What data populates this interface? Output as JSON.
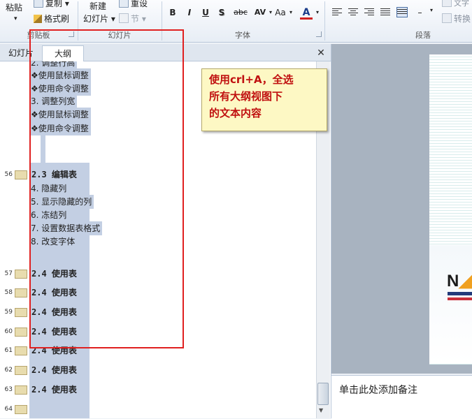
{
  "ribbon": {
    "clipboard": {
      "paste": "粘贴",
      "copy": "复制",
      "format_painter": "格式刷",
      "group_label": "剪贴板"
    },
    "slides": {
      "new_slide_line1": "新建",
      "new_slide_line2": "幻灯片",
      "reset": "重设",
      "section": "节",
      "group_label": "幻灯片"
    },
    "font": {
      "bold": "B",
      "italic": "I",
      "underline": "U",
      "shadow": "S",
      "strike": "abc",
      "spacing": "AV",
      "case": "Aa",
      "color": "A",
      "group_label": "字体",
      "color_accent": "#d02020"
    },
    "paragraph": {
      "group_label": "段落",
      "text_direction": "文字",
      "convert": "转换"
    }
  },
  "pane": {
    "tabs": [
      "幻灯片",
      "大纲"
    ],
    "active_tab": "大纲",
    "close": "✕"
  },
  "outline": {
    "top_items": [
      {
        "text": "2. 调整行高",
        "kind": "num"
      },
      {
        "text": "❖使用鼠标调整",
        "kind": "bul"
      },
      {
        "text": "❖使用命令调整",
        "kind": "bul"
      },
      {
        "text": "3. 调整列宽",
        "kind": "num"
      },
      {
        "text": "❖使用鼠标调整",
        "kind": "bul"
      },
      {
        "text": "❖使用命令调整",
        "kind": "bul"
      }
    ],
    "slide56": {
      "num": "56",
      "title": "2.3 编辑表"
    },
    "slide56_items": [
      "4. 隐藏列",
      "5. 显示隐藏的列",
      "6. 冻结列",
      "7. 设置数据表格式",
      "8. 改变字体"
    ],
    "slides_repeat": [
      {
        "num": "57",
        "title": "2.4 使用表"
      },
      {
        "num": "58",
        "title": "2.4 使用表"
      },
      {
        "num": "59",
        "title": "2.4 使用表"
      },
      {
        "num": "60",
        "title": "2.4 使用表"
      },
      {
        "num": "61",
        "title": "2.4 使用表"
      },
      {
        "num": "62",
        "title": "2.4 使用表"
      },
      {
        "num": "63",
        "title": "2.4 使用表"
      },
      {
        "num": "64",
        "title": ""
      }
    ]
  },
  "callout": {
    "text": "使用crl+A，全选\n所有大纲视图下\n的文本内容"
  },
  "notes": {
    "placeholder": "单击此处添加备注"
  }
}
